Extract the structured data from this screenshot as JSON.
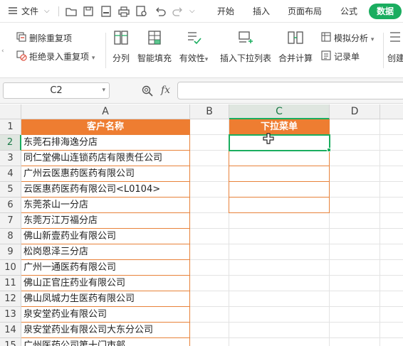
{
  "menubar": {
    "file_label": "文件",
    "tabs": [
      "开始",
      "插入",
      "页面布局",
      "公式",
      "数据"
    ],
    "active_tab": "数据"
  },
  "ribbon": {
    "remove_duplicates": "删除重复项",
    "reject_duplicates": "拒绝录入重复项",
    "split_columns": "分列",
    "smart_fill": "智能填充",
    "validity": "有效性",
    "insert_dropdown": "插入下拉列表",
    "consolidate": "合并计算",
    "simulate": "模拟分析",
    "record_form": "记录单",
    "create": "创建"
  },
  "formula_bar": {
    "name_box": "C2",
    "fx": "fx",
    "formula": ""
  },
  "grid": {
    "columns": [
      "A",
      "B",
      "C",
      "D"
    ],
    "rows": [
      "1",
      "2",
      "3",
      "4",
      "5",
      "6",
      "7",
      "8",
      "9",
      "10",
      "11",
      "12",
      "13",
      "14",
      "15"
    ],
    "a_header": "客户名称",
    "c_header": "下拉菜单",
    "a_values": [
      "东莞石排海逸分店",
      "同仁堂佛山连锁药店有限责任公司",
      "广州云医惠药医药有限公司",
      "云医惠药医药有限公司<L0104>",
      "东莞茶山一分店",
      "东莞万江万福分店",
      "佛山新壹药业有限公司",
      "松岗恩泽三分店",
      "广州一通医药有限公司",
      "佛山正官庄药业有限公司",
      "佛山凤城力生医药有限公司",
      "泉安堂药业有限公司",
      "泉安堂药业有限公司大东分公司",
      "广州医药公司第十门市部"
    ]
  },
  "colors": {
    "accent_green": "#1aad5f",
    "header_orange": "#ee7d31"
  }
}
